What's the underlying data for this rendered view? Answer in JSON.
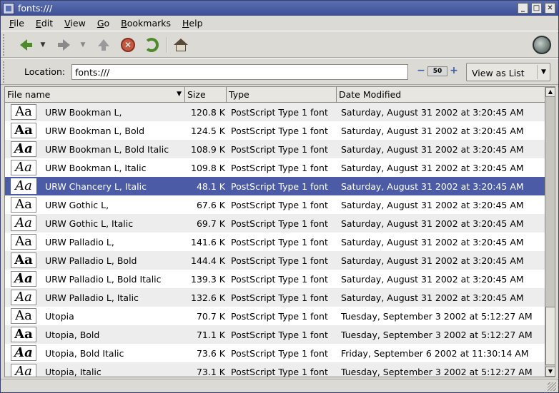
{
  "window": {
    "title": "fonts:///",
    "controls": [
      "_",
      "□",
      "✕"
    ]
  },
  "menu": [
    {
      "label": "File",
      "mnemonic": "F",
      "rest": "ile"
    },
    {
      "label": "Edit",
      "mnemonic": "E",
      "rest": "dit"
    },
    {
      "label": "View",
      "mnemonic": "V",
      "rest": "iew"
    },
    {
      "label": "Go",
      "mnemonic": "G",
      "rest": "o"
    },
    {
      "label": "Bookmarks",
      "mnemonic": "B",
      "rest": "ookmarks"
    },
    {
      "label": "Help",
      "mnemonic": "H",
      "rest": "elp"
    }
  ],
  "toolbar": {
    "back_icon": "back-arrow-icon",
    "forward_icon": "forward-arrow-icon",
    "up_icon": "up-arrow-icon",
    "stop_icon": "stop-icon",
    "reload_icon": "reload-icon",
    "home_icon": "home-icon",
    "stop_glyph": "✕"
  },
  "location": {
    "label": "Location:",
    "value": "fonts:///"
  },
  "zoom": {
    "value": "50",
    "minus": "−",
    "plus": "+"
  },
  "view_as": {
    "label": "View as List"
  },
  "columns": {
    "name": "File name",
    "size": "Size",
    "type": "Type",
    "date": "Date Modified"
  },
  "files": [
    {
      "glyph": "Aa",
      "style": "normal",
      "weight": "normal",
      "name": "URW Bookman L,",
      "size": "120.8 K",
      "type": "PostScript Type 1 font",
      "date": "Saturday, August 31 2002 at 3:20:45 AM",
      "selected": false
    },
    {
      "glyph": "Aa",
      "style": "normal",
      "weight": "bold",
      "name": "URW Bookman L, Bold",
      "size": "124.5 K",
      "type": "PostScript Type 1 font",
      "date": "Saturday, August 31 2002 at 3:20:45 AM",
      "selected": false
    },
    {
      "glyph": "Aa",
      "style": "italic",
      "weight": "bold",
      "name": "URW Bookman L, Bold Italic",
      "size": "108.9 K",
      "type": "PostScript Type 1 font",
      "date": "Saturday, August 31 2002 at 3:20:45 AM",
      "selected": false
    },
    {
      "glyph": "Aa",
      "style": "italic",
      "weight": "normal",
      "name": "URW Bookman L, Italic",
      "size": "109.8 K",
      "type": "PostScript Type 1 font",
      "date": "Saturday, August 31 2002 at 3:20:45 AM",
      "selected": false
    },
    {
      "glyph": "Aa",
      "style": "italic",
      "weight": "normal",
      "name": "URW Chancery L, Italic",
      "size": "48.1 K",
      "type": "PostScript Type 1 font",
      "date": "Saturday, August 31 2002 at 3:20:45 AM",
      "selected": true
    },
    {
      "glyph": "Aa",
      "style": "normal",
      "weight": "normal",
      "name": "URW Gothic L,",
      "size": "67.6 K",
      "type": "PostScript Type 1 font",
      "date": "Saturday, August 31 2002 at 3:20:45 AM",
      "selected": false
    },
    {
      "glyph": "Aa",
      "style": "italic",
      "weight": "normal",
      "name": "URW Gothic L, Italic",
      "size": "69.7 K",
      "type": "PostScript Type 1 font",
      "date": "Saturday, August 31 2002 at 3:20:45 AM",
      "selected": false
    },
    {
      "glyph": "Aa",
      "style": "normal",
      "weight": "normal",
      "name": "URW Palladio L,",
      "size": "141.6 K",
      "type": "PostScript Type 1 font",
      "date": "Saturday, August 31 2002 at 3:20:45 AM",
      "selected": false
    },
    {
      "glyph": "Aa",
      "style": "normal",
      "weight": "bold",
      "name": "URW Palladio L, Bold",
      "size": "144.4 K",
      "type": "PostScript Type 1 font",
      "date": "Saturday, August 31 2002 at 3:20:45 AM",
      "selected": false
    },
    {
      "glyph": "Aa",
      "style": "italic",
      "weight": "bold",
      "name": "URW Palladio L, Bold Italic",
      "size": "139.3 K",
      "type": "PostScript Type 1 font",
      "date": "Saturday, August 31 2002 at 3:20:45 AM",
      "selected": false
    },
    {
      "glyph": "Aa",
      "style": "italic",
      "weight": "normal",
      "name": "URW Palladio L, Italic",
      "size": "132.6 K",
      "type": "PostScript Type 1 font",
      "date": "Saturday, August 31 2002 at 3:20:45 AM",
      "selected": false
    },
    {
      "glyph": "Aa",
      "style": "normal",
      "weight": "normal",
      "name": "Utopia",
      "size": "70.7 K",
      "type": "PostScript Type 1 font",
      "date": "Tuesday, September 3 2002 at 5:12:27 AM",
      "selected": false
    },
    {
      "glyph": "Aa",
      "style": "normal",
      "weight": "bold",
      "name": "Utopia, Bold",
      "size": "71.1 K",
      "type": "PostScript Type 1 font",
      "date": "Tuesday, September 3 2002 at 5:12:27 AM",
      "selected": false
    },
    {
      "glyph": "Aa",
      "style": "italic",
      "weight": "bold",
      "name": "Utopia, Bold Italic",
      "size": "73.6 K",
      "type": "PostScript Type 1 font",
      "date": "Friday, September 6 2002 at 11:30:14 AM",
      "selected": false
    },
    {
      "glyph": "Aa",
      "style": "italic",
      "weight": "normal",
      "name": "Utopia, Italic",
      "size": "73.1 K",
      "type": "PostScript Type 1 font",
      "date": "Tuesday, September 3 2002 at 5:12:27 AM",
      "selected": false
    }
  ],
  "colors": {
    "selection": "#4b5ba6",
    "titlebar": "#3e4f95"
  }
}
